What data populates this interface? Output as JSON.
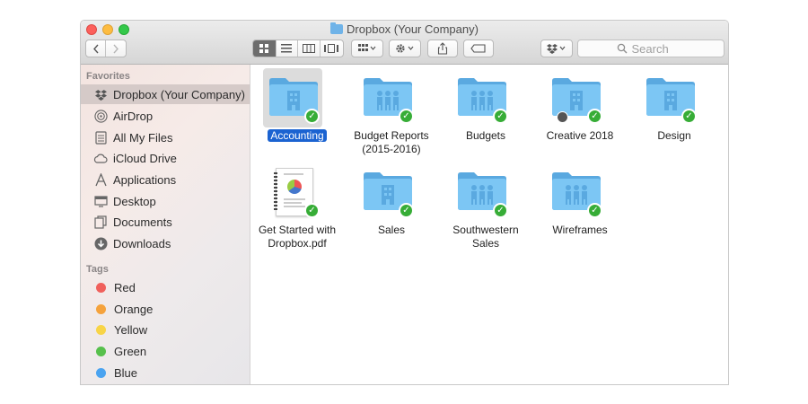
{
  "window": {
    "title": "Dropbox (Your Company)",
    "colors": {
      "close": "#fc605c",
      "minimize": "#fdbc40",
      "zoom": "#34c84a"
    }
  },
  "toolbar": {
    "back_icon": "chevron-left-icon",
    "forward_icon": "chevron-right-icon",
    "view_modes": [
      "icon-view-icon",
      "list-view-icon",
      "column-view-icon",
      "gallery-view-icon"
    ],
    "arrange_icon": "arrange-icon",
    "action_icon": "gear-icon",
    "share_icon": "share-icon",
    "tag_icon": "tag-icon",
    "dropbox_icon": "dropbox-icon",
    "search_placeholder": "Search"
  },
  "sidebar": {
    "favorites_heading": "Favorites",
    "favorites": [
      {
        "label": "Dropbox (Your Company)",
        "icon": "dropbox-icon",
        "selected": true
      },
      {
        "label": "AirDrop",
        "icon": "airdrop-icon"
      },
      {
        "label": "All My Files",
        "icon": "all-files-icon"
      },
      {
        "label": "iCloud Drive",
        "icon": "cloud-icon"
      },
      {
        "label": "Applications",
        "icon": "applications-icon"
      },
      {
        "label": "Desktop",
        "icon": "desktop-icon"
      },
      {
        "label": "Documents",
        "icon": "documents-icon"
      },
      {
        "label": "Downloads",
        "icon": "downloads-icon"
      }
    ],
    "tags_heading": "Tags",
    "tags": [
      {
        "label": "Red",
        "color": "#f0605c"
      },
      {
        "label": "Orange",
        "color": "#f5a23c"
      },
      {
        "label": "Yellow",
        "color": "#f8d447"
      },
      {
        "label": "Green",
        "color": "#57c04c"
      },
      {
        "label": "Blue",
        "color": "#4aa3f0"
      }
    ]
  },
  "files": [
    {
      "label": "Accounting",
      "type": "folder",
      "glyph": "building",
      "selected": true,
      "synced": true
    },
    {
      "label": "Budget Reports (2015-2016)",
      "type": "folder",
      "glyph": "people",
      "synced": true
    },
    {
      "label": "Budgets",
      "type": "folder",
      "glyph": "people",
      "synced": true
    },
    {
      "label": "Creative 2018",
      "type": "folder",
      "glyph": "building",
      "synced": true,
      "locked": true
    },
    {
      "label": "Design",
      "type": "folder",
      "glyph": "building",
      "synced": true
    },
    {
      "label": "Get Started with Dropbox.pdf",
      "type": "pdf",
      "synced": true
    },
    {
      "label": "Sales",
      "type": "folder",
      "glyph": "building",
      "synced": true
    },
    {
      "label": "Southwestern Sales",
      "type": "folder",
      "glyph": "people",
      "synced": true
    },
    {
      "label": "Wireframes",
      "type": "folder",
      "glyph": "people",
      "synced": true
    }
  ],
  "colors": {
    "folder": "#6ebdf0",
    "sync_badge": "#37ad37",
    "selection": "#1b63d1"
  }
}
